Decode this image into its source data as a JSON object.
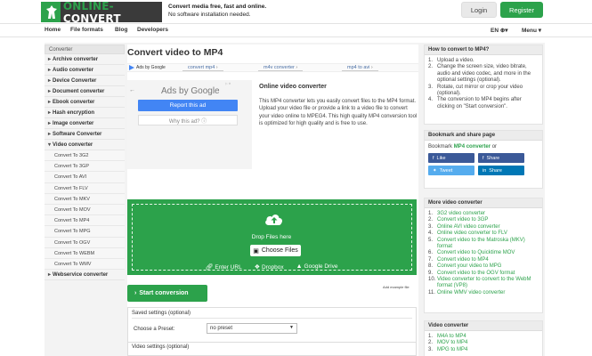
{
  "header": {
    "logo_prefix": "ONLINE-",
    "logo_suffix": "CONVERT",
    "tagline1": "Convert media free, fast and online.",
    "tagline2": "No software installation needed.",
    "login": "Login",
    "register": "Register"
  },
  "nav": {
    "items": [
      "Home",
      "File formats",
      "Blog",
      "Developers"
    ],
    "lang": "EN",
    "menu": "Menu"
  },
  "sidebar": {
    "title": "Converter",
    "items": [
      "Archive converter",
      "Audio converter",
      "Device Converter",
      "Document converter",
      "Ebook converter",
      "Hash encryption",
      "Image converter",
      "Software Converter",
      "Video converter"
    ],
    "sub_items": [
      "Convert To 3G2",
      "Convert To 3GP",
      "Convert To AVI",
      "Convert To FLV",
      "Convert To MKV",
      "Convert To MOV",
      "Convert To MP4",
      "Convert To MPG",
      "Convert To OGV",
      "Convert To WEBM",
      "Convert To WMV"
    ],
    "last_item": "Webservice converter"
  },
  "main": {
    "title": "Convert video to MP4",
    "ads_by": "Ads by Google",
    "ad_links": [
      "convert mp4",
      "m4v converter",
      "mp4 to avi"
    ],
    "ad_google": "Ads by Google",
    "report": "Report this ad",
    "why": "Why this ad? ⓘ",
    "intro_title": "Online video converter",
    "intro_text": "This MP4 converter lets you easily convert files to the MP4 format. Upload your video file or provide a link to a video file to convert your video online to MPEG4. This high quality MP4 conversion tool is optimized for high quality and is free to use.",
    "drop_files": "Drop Files here",
    "choose_files": "Choose Files",
    "enter_url": "Enter URL",
    "dropbox": "Dropbox",
    "google_drive": "Google Drive",
    "start": "Start conversion",
    "add_example": "Add example file",
    "saved_settings": "Saved settings (optional)",
    "choose_preset_label": "Choose a Preset:",
    "preset_value": "no preset",
    "video_settings": "Video settings (optional)"
  },
  "right": {
    "howto_title": "How to convert to MP4?",
    "howto_steps": [
      "Upload a video.",
      "Change the screen size, video bitrate, audio and video codec, and more in the optional settings (optional).",
      "Rotate, cut mirror or crop your video (optional).",
      "The conversion to MP4 begins after clicking on \"Start conversion\"."
    ],
    "bookmark_title": "Bookmark and share page",
    "bookmark_prefix": "Bookmark",
    "bookmark_link": "MP4 converter",
    "bookmark_suffix": "or",
    "share_buttons": [
      "Like",
      "Share",
      "Tweet",
      "Share"
    ],
    "more_title": "More video converter",
    "more_items": [
      "3G2 video converter",
      "Convert video to 3GP",
      "Online AVI video converter",
      "Online video converter to FLV",
      "Convert video to the Matroska (MKV) format",
      "Convert video to Quicktime MOV",
      "Convert video to MP4",
      "Convert your video to MPG",
      "Convert video to the OGV format",
      "Video converter to convert to the WebM format (VP8)",
      "Online WMV video converter"
    ],
    "vc_title": "Video converter",
    "vc_items": [
      "M4A to MP4",
      "MOV to MP4",
      "MPG to MP4"
    ]
  }
}
